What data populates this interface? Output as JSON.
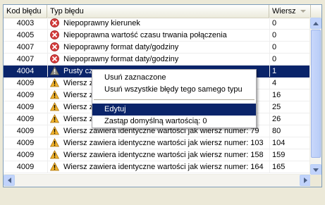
{
  "columns": {
    "code": "Kod błędu",
    "type": "Typ błędu",
    "row": "Wiersz"
  },
  "colors": {
    "selection": "#0a246a",
    "error": "#d43b3b",
    "warning": "#f2b32b",
    "panel_border": "#7f9db9"
  },
  "rows": [
    {
      "code": "4003",
      "icon": "error-icon",
      "type": "Niepoprawny kierunek",
      "row": "0"
    },
    {
      "code": "4005",
      "icon": "error-icon",
      "type": "Niepoprawna wartość czasu trwania połączenia",
      "row": "0"
    },
    {
      "code": "4007",
      "icon": "error-icon",
      "type": "Niepoprawny format daty/godziny",
      "row": "0"
    },
    {
      "code": "4007",
      "icon": "error-icon",
      "type": "Niepoprawny format daty/godziny",
      "row": "0"
    },
    {
      "code": "4004",
      "icon": "warning-gray-icon",
      "type": "Pusty cz",
      "row": "1",
      "selected": true
    },
    {
      "code": "4009",
      "icon": "warning-icon",
      "type": "Wiersz z",
      "row": "4"
    },
    {
      "code": "4009",
      "icon": "warning-icon",
      "type": "Wiersz z",
      "row": "16"
    },
    {
      "code": "4009",
      "icon": "warning-icon",
      "type": "Wiersz z",
      "row": "25"
    },
    {
      "code": "4009",
      "icon": "warning-icon",
      "type": "Wiersz z",
      "row": "26"
    },
    {
      "code": "4009",
      "icon": "warning-icon",
      "type": "Wiersz zawiera identyczne wartości jak wiersz numer: 79",
      "row": "80"
    },
    {
      "code": "4009",
      "icon": "warning-icon",
      "type": "Wiersz zawiera identyczne wartości jak wiersz numer: 103",
      "row": "104"
    },
    {
      "code": "4009",
      "icon": "warning-icon",
      "type": "Wiersz zawiera identyczne wartości jak wiersz numer: 158",
      "row": "159"
    },
    {
      "code": "4009",
      "icon": "warning-icon",
      "type": "Wiersz zawiera identyczne wartości jak wiersz numer: 164",
      "row": "165"
    }
  ],
  "context_menu": {
    "items": [
      {
        "label": "Usuń zaznaczone",
        "name": "menu-item-remove-selected"
      },
      {
        "label": "Usuń wszystkie błędy tego samego typu",
        "name": "menu-item-remove-all-same-type"
      },
      {
        "separator": true
      },
      {
        "label": "Edytuj",
        "name": "menu-item-edit",
        "highlighted": true
      },
      {
        "label": "Zastąp domyślną wartością: 0",
        "name": "menu-item-replace-default"
      }
    ]
  }
}
